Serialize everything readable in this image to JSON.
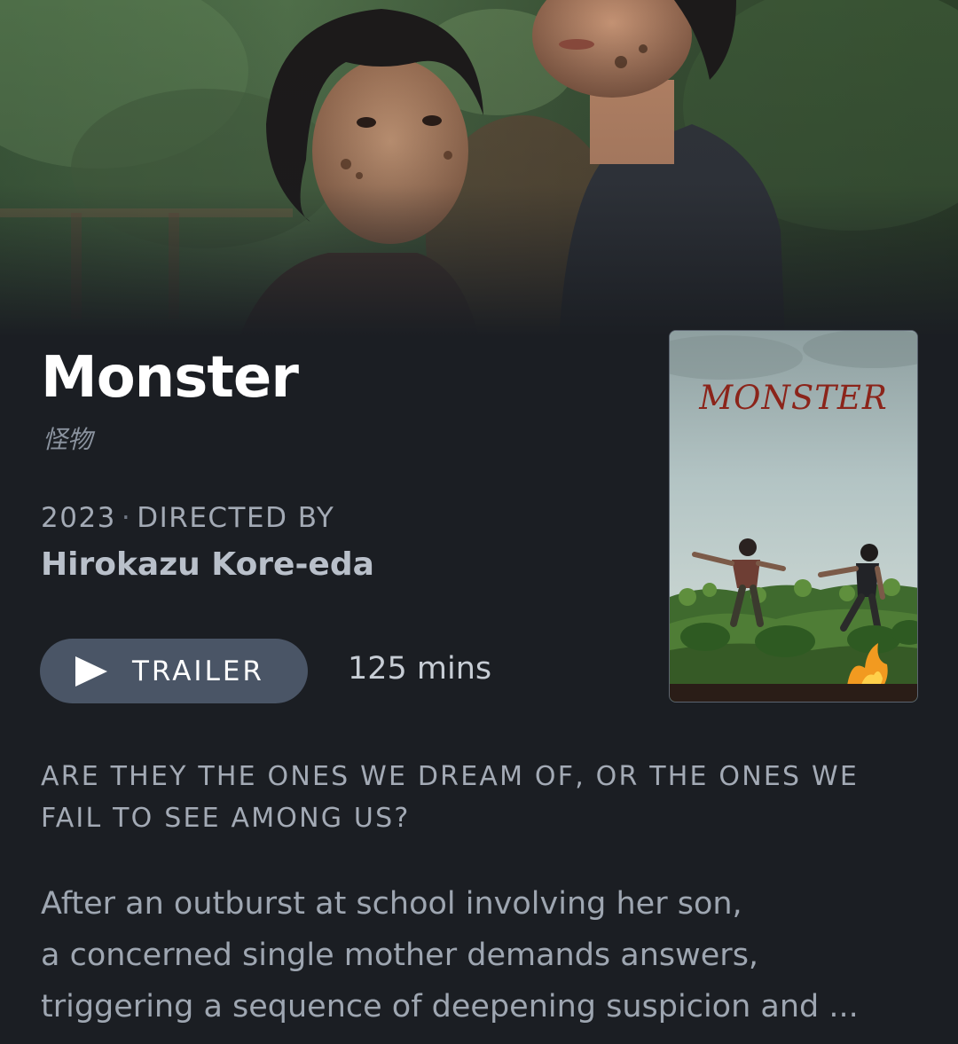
{
  "film": {
    "title": "Monster",
    "original_title": "怪物",
    "year": "2023",
    "separator": "·",
    "directed_by_label": "DIRECTED BY",
    "director": "Hirokazu Kore-eda",
    "runtime": "125 mins",
    "tagline": "ARE THEY THE ONES WE DREAM OF, OR THE ONES WE FAIL TO SEE AMONG US?",
    "overview_lines": [
      "After an outburst at school involving her son,",
      "a concerned single mother demands answers,",
      "triggering a sequence of deepening suspicion and ..."
    ]
  },
  "actions": {
    "trailer_label": "TRAILER",
    "trailer_icon": "play-icon"
  },
  "poster": {
    "title_text": "MONSTER"
  },
  "colors": {
    "background": "#1b1e23",
    "trailer_button": "#4a5566",
    "muted_text": "#a3aab5",
    "poster_title": "#8b241a"
  }
}
